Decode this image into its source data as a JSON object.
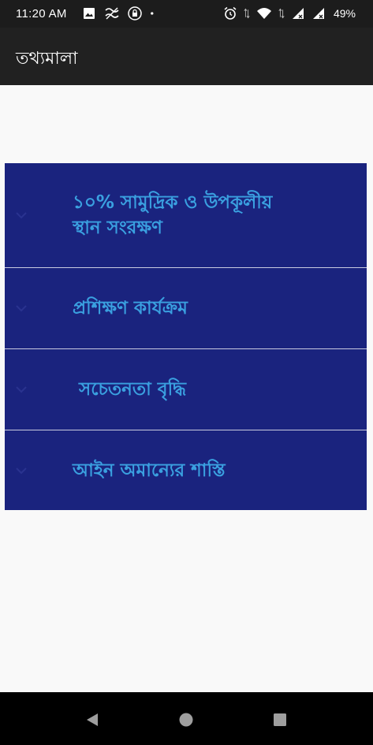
{
  "status_bar": {
    "time": "11:20 AM",
    "battery": "49%",
    "left_icons": [
      "image-icon",
      "data-saver-icon",
      "lock-icon",
      "dot-icon"
    ],
    "right_icons": [
      "alarm-icon",
      "wifi-icon",
      "signal-icon",
      "signal-icon"
    ]
  },
  "app_bar": {
    "title": "তথ্যমালা"
  },
  "accordion": {
    "items": [
      {
        "label_line1": "১০% সামুদ্রিক ও উপকূলীয়",
        "label_line2": "স্থান সংরক্ষণ",
        "icon": "chevron-down-icon"
      },
      {
        "label": "প্রশিক্ষণ কার্যক্রম",
        "icon": "chevron-down-icon"
      },
      {
        "label": " সচেতনতা বৃদ্ধি",
        "icon": "chevron-down-icon"
      },
      {
        "label": "আইন অমান্যের শাস্তি",
        "icon": "chevron-down-icon"
      }
    ],
    "background_color": "#1a237e",
    "text_color": "#3aa0e0"
  },
  "nav_bar": {
    "buttons": [
      "back-icon",
      "home-icon",
      "recents-icon"
    ]
  }
}
